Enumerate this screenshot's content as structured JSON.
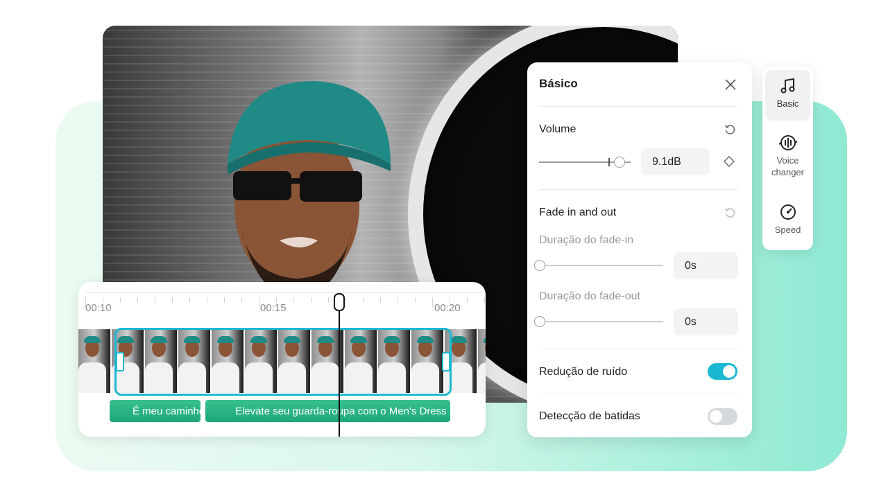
{
  "panel": {
    "title": "Básico",
    "volume": {
      "label": "Volume",
      "value": "9.1dB",
      "level": 0.87
    },
    "fade": {
      "label": "Fade in and out",
      "fade_in": {
        "label": "Duração do fade-in",
        "value": "0s",
        "level": 0
      },
      "fade_out": {
        "label": "Duração do fade-out",
        "value": "0s",
        "level": 0
      }
    },
    "noise_reduction": {
      "label": "Redução de ruído",
      "on": true
    },
    "beat_detection": {
      "label": "Detecção de batidas",
      "on": false
    }
  },
  "side_tools": [
    {
      "label": "Basic",
      "icon": "music-note-icon"
    },
    {
      "label": "Voice\nchanger",
      "icon": "voice-changer-icon"
    },
    {
      "label": "Speed",
      "icon": "speed-icon"
    }
  ],
  "timeline": {
    "times": [
      "00:10",
      "00:15",
      "00:20"
    ],
    "audio_clips": [
      "É meu caminho",
      "Elevate seu guarda-roupa com o Men's Dress"
    ]
  },
  "colors": {
    "accent": "#1bb8d3",
    "audio": "#2bb586",
    "toggle_off": "#d5d8dc"
  }
}
